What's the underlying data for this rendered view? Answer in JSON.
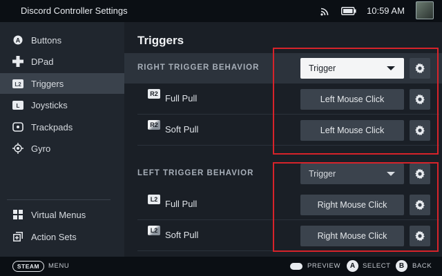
{
  "header": {
    "app_title": "Discord Controller Settings",
    "time": "10:59 AM",
    "icons": {
      "wifi": "wifi-icon",
      "battery": "battery-icon",
      "avatar": "avatar"
    }
  },
  "sidebar": {
    "items": [
      {
        "label": "Buttons",
        "icon": "a-button-icon"
      },
      {
        "label": "DPad",
        "icon": "dpad-icon"
      },
      {
        "label": "Triggers",
        "icon": "l2-trigger-icon",
        "active": true
      },
      {
        "label": "Joysticks",
        "icon": "joystick-icon"
      },
      {
        "label": "Trackpads",
        "icon": "trackpad-icon"
      },
      {
        "label": "Gyro",
        "icon": "gyro-icon"
      }
    ],
    "bottom_items": [
      {
        "label": "Virtual Menus",
        "icon": "virtual-menus-icon"
      },
      {
        "label": "Action Sets",
        "icon": "action-sets-icon"
      }
    ]
  },
  "main": {
    "title": "Triggers",
    "right_trigger": {
      "label": "RIGHT TRIGGER BEHAVIOR",
      "dropdown_value": "Trigger",
      "rows": [
        {
          "icon_text": "R2",
          "label": "Full Pull",
          "action": "Left Mouse Click"
        },
        {
          "icon_text": "R2",
          "label": "Soft Pull",
          "action": "Left Mouse Click"
        }
      ]
    },
    "left_trigger": {
      "label": "LEFT TRIGGER BEHAVIOR",
      "dropdown_value": "Trigger",
      "rows": [
        {
          "icon_text": "L2",
          "label": "Full Pull",
          "action": "Right Mouse Click"
        },
        {
          "icon_text": "L2",
          "label": "Soft Pull",
          "action": "Right Mouse Click"
        }
      ]
    }
  },
  "footer": {
    "steam": "STEAM",
    "menu": "MENU",
    "preview": "PREVIEW",
    "select_button": "A",
    "select": "SELECT",
    "back_button": "B",
    "back": "BACK"
  },
  "colors": {
    "highlight_box": "#d8232a",
    "background": "#1a1f26",
    "sidebar": "#20262e",
    "sidebar_active": "#3a424c",
    "button": "#3b434d"
  }
}
